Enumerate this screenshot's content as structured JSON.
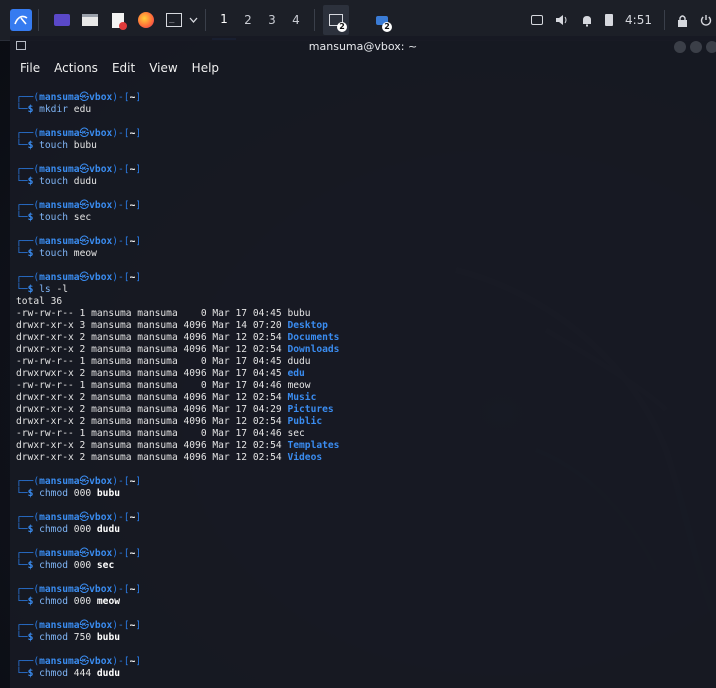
{
  "panel": {
    "workspaces": [
      "1",
      "2",
      "3",
      "4"
    ],
    "active_workspace": "1",
    "taskbar_badges": [
      "2",
      "2"
    ],
    "clock": "4:51"
  },
  "window": {
    "title": "mansuma@vbox: ~",
    "menu": [
      "File",
      "Actions",
      "Edit",
      "View",
      "Help"
    ]
  },
  "prompt": {
    "user": "mansuma",
    "host": "vbox",
    "dir": "~"
  },
  "commands_before": [
    {
      "cmd": "mkdir",
      "arg": "edu"
    },
    {
      "cmd": "touch",
      "arg": "bubu"
    },
    {
      "cmd": "touch",
      "arg": "dudu"
    },
    {
      "cmd": "touch",
      "arg": "sec"
    },
    {
      "cmd": "touch",
      "arg": "meow"
    },
    {
      "cmd": "ls",
      "arg": "-l"
    }
  ],
  "ls_total": "total 36",
  "listing": [
    {
      "perm": "-rw-rw-r--",
      "links": "1",
      "owner": "mansuma",
      "group": "mansuma",
      "size": "0",
      "month": "Mar",
      "day": "17",
      "time": "04:45",
      "name": "bubu",
      "dir": false
    },
    {
      "perm": "drwxr-xr-x",
      "links": "3",
      "owner": "mansuma",
      "group": "mansuma",
      "size": "4096",
      "month": "Mar",
      "day": "14",
      "time": "07:20",
      "name": "Desktop",
      "dir": true
    },
    {
      "perm": "drwxr-xr-x",
      "links": "2",
      "owner": "mansuma",
      "group": "mansuma",
      "size": "4096",
      "month": "Mar",
      "day": "12",
      "time": "02:54",
      "name": "Documents",
      "dir": true
    },
    {
      "perm": "drwxr-xr-x",
      "links": "2",
      "owner": "mansuma",
      "group": "mansuma",
      "size": "4096",
      "month": "Mar",
      "day": "12",
      "time": "02:54",
      "name": "Downloads",
      "dir": true
    },
    {
      "perm": "-rw-rw-r--",
      "links": "1",
      "owner": "mansuma",
      "group": "mansuma",
      "size": "0",
      "month": "Mar",
      "day": "17",
      "time": "04:45",
      "name": "dudu",
      "dir": false
    },
    {
      "perm": "drwxrwxr-x",
      "links": "2",
      "owner": "mansuma",
      "group": "mansuma",
      "size": "4096",
      "month": "Mar",
      "day": "17",
      "time": "04:45",
      "name": "edu",
      "dir": true
    },
    {
      "perm": "-rw-rw-r--",
      "links": "1",
      "owner": "mansuma",
      "group": "mansuma",
      "size": "0",
      "month": "Mar",
      "day": "17",
      "time": "04:46",
      "name": "meow",
      "dir": false
    },
    {
      "perm": "drwxr-xr-x",
      "links": "2",
      "owner": "mansuma",
      "group": "mansuma",
      "size": "4096",
      "month": "Mar",
      "day": "12",
      "time": "02:54",
      "name": "Music",
      "dir": true
    },
    {
      "perm": "drwxr-xr-x",
      "links": "2",
      "owner": "mansuma",
      "group": "mansuma",
      "size": "4096",
      "month": "Mar",
      "day": "17",
      "time": "04:29",
      "name": "Pictures",
      "dir": true
    },
    {
      "perm": "drwxr-xr-x",
      "links": "2",
      "owner": "mansuma",
      "group": "mansuma",
      "size": "4096",
      "month": "Mar",
      "day": "12",
      "time": "02:54",
      "name": "Public",
      "dir": true
    },
    {
      "perm": "-rw-rw-r--",
      "links": "1",
      "owner": "mansuma",
      "group": "mansuma",
      "size": "0",
      "month": "Mar",
      "day": "17",
      "time": "04:46",
      "name": "sec",
      "dir": false
    },
    {
      "perm": "drwxr-xr-x",
      "links": "2",
      "owner": "mansuma",
      "group": "mansuma",
      "size": "4096",
      "month": "Mar",
      "day": "12",
      "time": "02:54",
      "name": "Templates",
      "dir": true
    },
    {
      "perm": "drwxr-xr-x",
      "links": "2",
      "owner": "mansuma",
      "group": "mansuma",
      "size": "4096",
      "month": "Mar",
      "day": "12",
      "time": "02:54",
      "name": "Videos",
      "dir": true
    }
  ],
  "commands_after": [
    {
      "cmd": "chmod",
      "mode": "000",
      "arg": "bubu"
    },
    {
      "cmd": "chmod",
      "mode": "000",
      "arg": "dudu"
    },
    {
      "cmd": "chmod",
      "mode": "000",
      "arg": "sec"
    },
    {
      "cmd": "chmod",
      "mode": "000",
      "arg": "meow"
    },
    {
      "cmd": "chmod",
      "mode": "750",
      "arg": "bubu"
    },
    {
      "cmd": "chmod",
      "mode": "444",
      "arg": "dudu"
    }
  ],
  "colors": {
    "accent": "#367bf0",
    "prompt_blue": "#3a8cf0",
    "panel_bg": "#1c1f27",
    "terminal_bg": "#171a23"
  },
  "icons": [
    "kali-menu-icon",
    "workspace-overview-icon",
    "file-manager-icon",
    "text-editor-icon",
    "firefox-icon",
    "terminal-icon",
    "chevron-down-icon",
    "terminal-task-icon",
    "vm-task-icon",
    "screen-icon",
    "volume-icon",
    "notification-bell-icon",
    "battery-icon",
    "lock-icon",
    "power-icon",
    "terminal-window-icon"
  ]
}
